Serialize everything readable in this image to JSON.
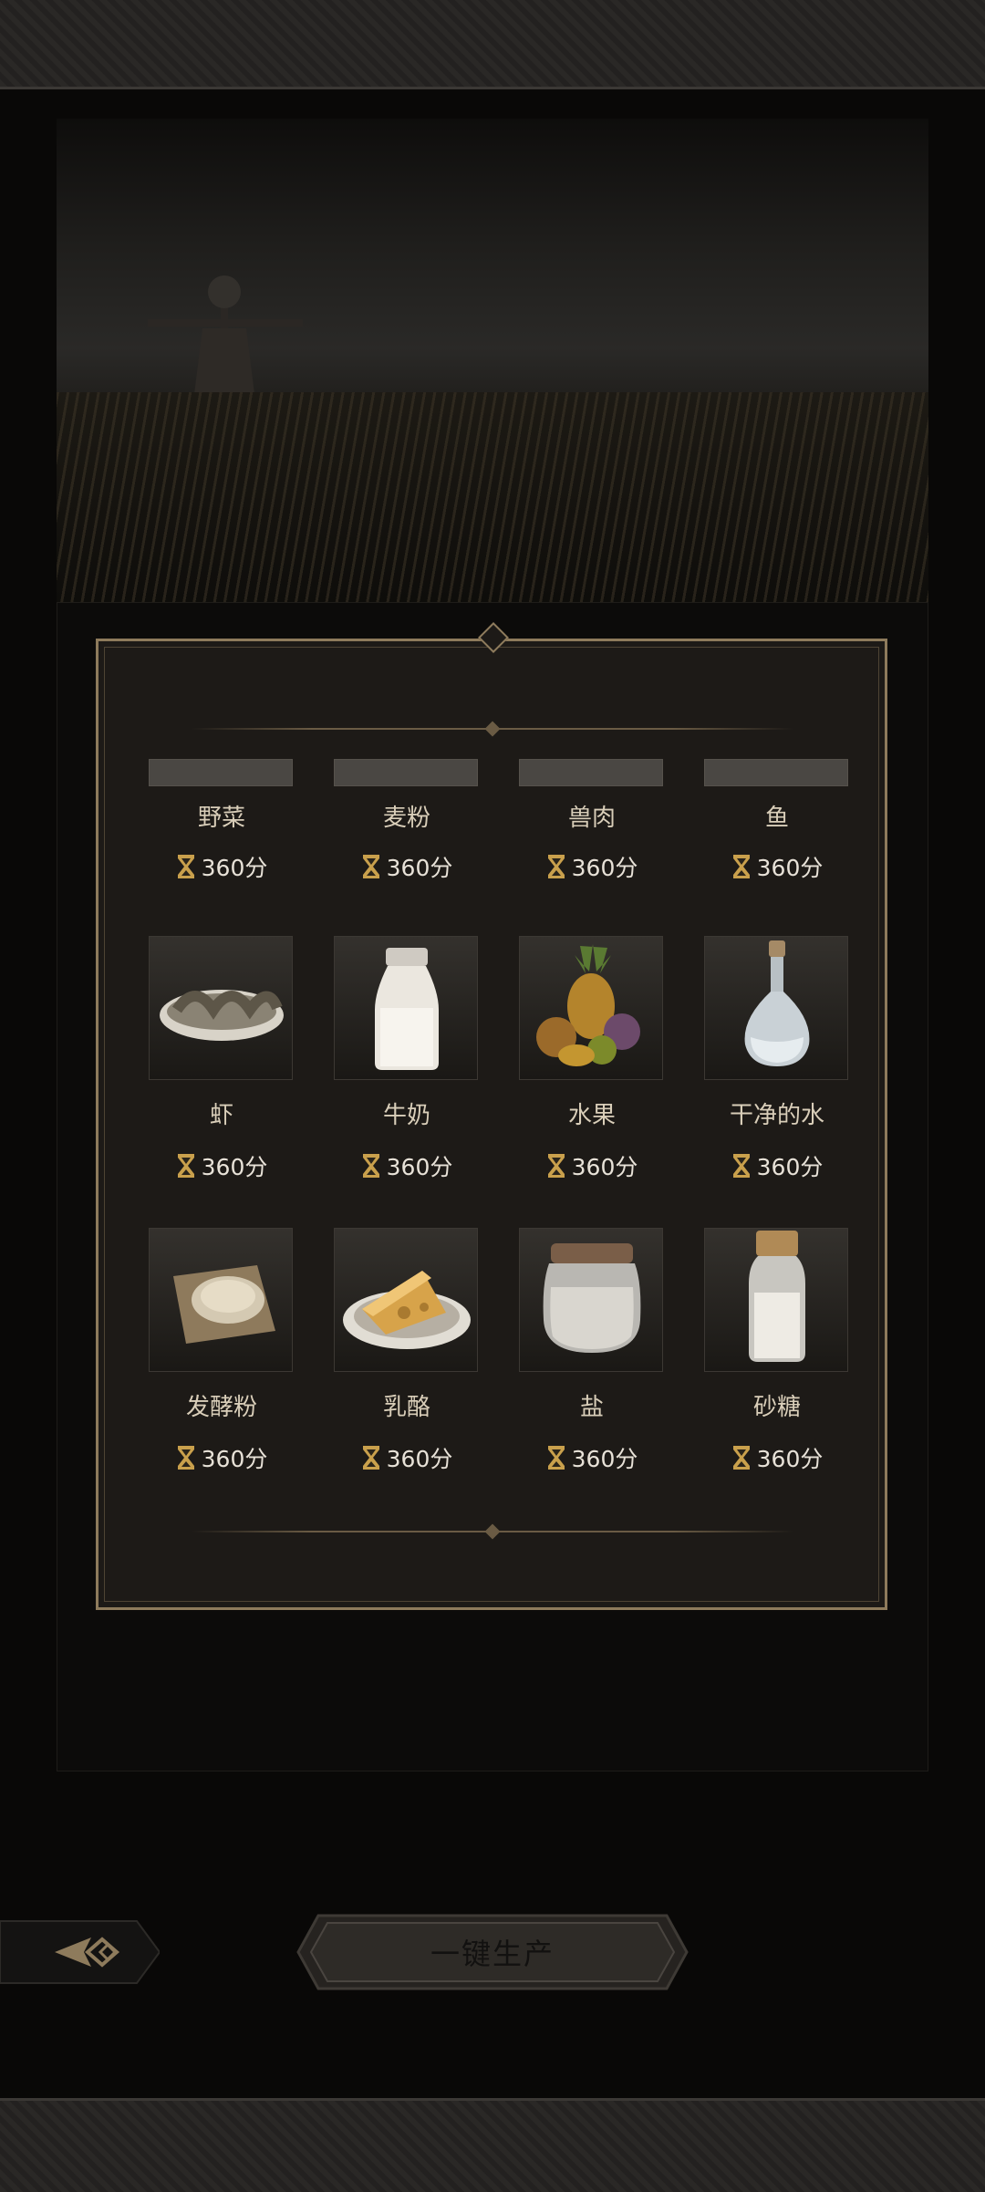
{
  "action_button_label": "一键生产",
  "items": [
    {
      "name": "野菜",
      "time": "360分",
      "icon": "wild-vegetables-icon"
    },
    {
      "name": "麦粉",
      "time": "360分",
      "icon": "wheat-flour-icon"
    },
    {
      "name": "兽肉",
      "time": "360分",
      "icon": "meat-icon"
    },
    {
      "name": "鱼",
      "time": "360分",
      "icon": "fish-icon"
    },
    {
      "name": "虾",
      "time": "360分",
      "icon": "shrimp-icon"
    },
    {
      "name": "牛奶",
      "time": "360分",
      "icon": "milk-bottle-icon"
    },
    {
      "name": "水果",
      "time": "360分",
      "icon": "fruit-icon"
    },
    {
      "name": "干净的水",
      "time": "360分",
      "icon": "water-carafe-icon"
    },
    {
      "name": "发酵粉",
      "time": "360分",
      "icon": "yeast-powder-icon"
    },
    {
      "name": "乳酪",
      "time": "360分",
      "icon": "cheese-icon"
    },
    {
      "name": "盐",
      "time": "360分",
      "icon": "salt-jar-icon"
    },
    {
      "name": "砂糖",
      "time": "360分",
      "icon": "sugar-bottle-icon"
    }
  ],
  "colors": {
    "gold": "#c9a04c",
    "frame": "#8e7b5c",
    "text": "#d9ceb9"
  }
}
